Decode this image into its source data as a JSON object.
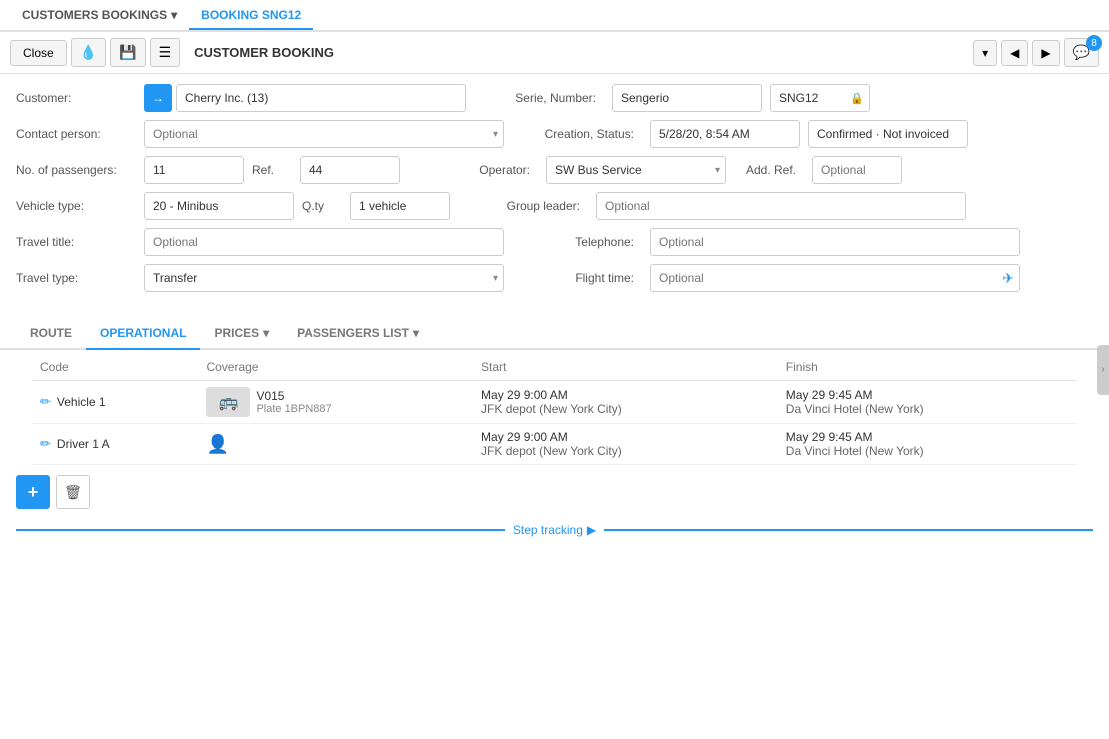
{
  "topNav": {
    "items": [
      {
        "id": "customers-bookings",
        "label": "CUSTOMERS BOOKINGS",
        "hasDropdown": true,
        "active": false
      },
      {
        "id": "booking-sng12",
        "label": "BOOKING SNG12",
        "hasDropdown": false,
        "active": true
      }
    ]
  },
  "toolbar": {
    "closeLabel": "Close",
    "title": "CUSTOMER BOOKING",
    "commentCount": "8"
  },
  "form": {
    "customerLabel": "Customer:",
    "customerValue": "Cherry Inc. (13)",
    "serieNumberLabel": "Serie, Number:",
    "serieValue": "Sengerio",
    "numberValue": "SNG12",
    "contactLabel": "Contact person:",
    "contactPlaceholder": "Optional",
    "creationStatusLabel": "Creation, Status:",
    "creationValue": "5/28/20, 8:54 AM",
    "statusValue": "Confirmed · Not invoiced",
    "passengersLabel": "No. of passengers:",
    "passengersValue": "11",
    "refLabel": "Ref.",
    "refValue": "44",
    "operatorLabel": "Operator:",
    "operatorValue": "SW Bus Service",
    "addRefLabel": "Add. Ref.",
    "addRefPlaceholder": "Optional",
    "vehicleTypeLabel": "Vehicle type:",
    "vehicleTypeValue": "20 - Minibus",
    "qtyLabel": "Q.ty",
    "qtyValue": "1 vehicle",
    "groupLeaderLabel": "Group leader:",
    "groupLeaderPlaceholder": "Optional",
    "travelTitleLabel": "Travel title:",
    "travelTitlePlaceholder": "Optional",
    "telephoneLabel": "Telephone:",
    "telephonePlaceholder": "Optional",
    "travelTypeLabel": "Travel type:",
    "travelTypeValue": "Transfer",
    "flightTimeLabel": "Flight time:",
    "flightTimePlaceholder": "Optional"
  },
  "tabs": [
    {
      "id": "route",
      "label": "ROUTE",
      "active": false,
      "hasDropdown": false
    },
    {
      "id": "operational",
      "label": "OPERATIONAL",
      "active": true,
      "hasDropdown": false
    },
    {
      "id": "prices",
      "label": "PRICES",
      "active": false,
      "hasDropdown": true
    },
    {
      "id": "passengers-list",
      "label": "PASSENGERS LIST",
      "active": false,
      "hasDropdown": true
    }
  ],
  "table": {
    "headers": [
      "Code",
      "Coverage",
      "Start",
      "Finish"
    ],
    "rows": [
      {
        "type": "vehicle",
        "code": "Vehicle 1",
        "vehicleName": "V015",
        "vehiclePlate": "Plate 1BPN887",
        "start": "May 29 9:00 AM",
        "startLocation": "JFK depot (New York City)",
        "finish": "May 29 9:45 AM",
        "finishLocation": "Da Vinci Hotel (New York)"
      },
      {
        "type": "driver",
        "code": "Driver 1 A",
        "start": "May 29 9:00 AM",
        "startLocation": "JFK depot (New York City)",
        "finish": "May 29 9:45 AM",
        "finishLocation": "Da Vinci Hotel (New York)"
      }
    ]
  },
  "actionButtons": {
    "addLabel": "+",
    "deleteLabel": "🗑"
  },
  "stepTracking": {
    "label": "Step tracking"
  }
}
